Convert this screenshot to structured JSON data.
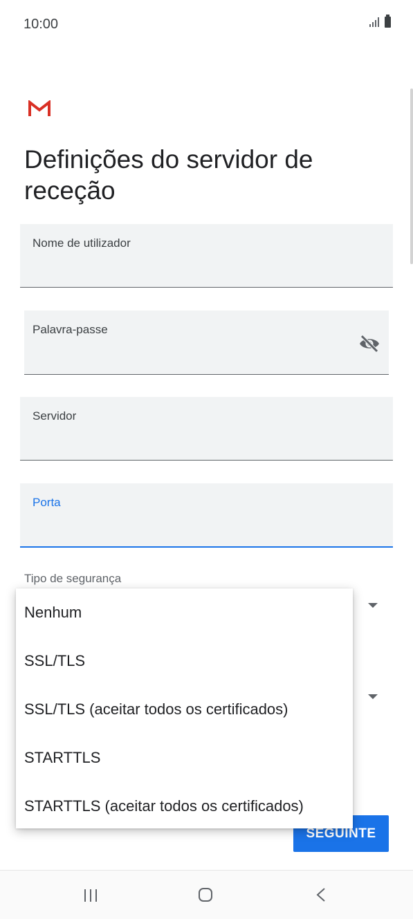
{
  "status_bar": {
    "time": "10:00"
  },
  "header": {
    "title": "Definições do servidor de receção"
  },
  "fields": {
    "username": {
      "label": "Nome de utilizador",
      "value": ""
    },
    "password": {
      "label": "Palavra-passe",
      "value": ""
    },
    "server": {
      "label": "Servidor",
      "value": ""
    },
    "port": {
      "label": "Porta",
      "value": ""
    }
  },
  "security": {
    "label": "Tipo de segurança",
    "options": [
      "Nenhum",
      "SSL/TLS",
      "SSL/TLS (aceitar todos os certificados)",
      "STARTTLS",
      "STARTTLS (aceitar todos os certificados)"
    ]
  },
  "next_button": {
    "label": "SEGUINTE"
  },
  "icons": {
    "app_logo": "gmail-icon",
    "password_toggle": "eye-off-icon",
    "nav_recents": "recents-icon",
    "nav_home": "home-icon",
    "nav_back": "back-icon"
  },
  "colors": {
    "accent": "#1a73e8",
    "gmail_red": "#d93025",
    "field_bg": "#f1f3f4"
  }
}
